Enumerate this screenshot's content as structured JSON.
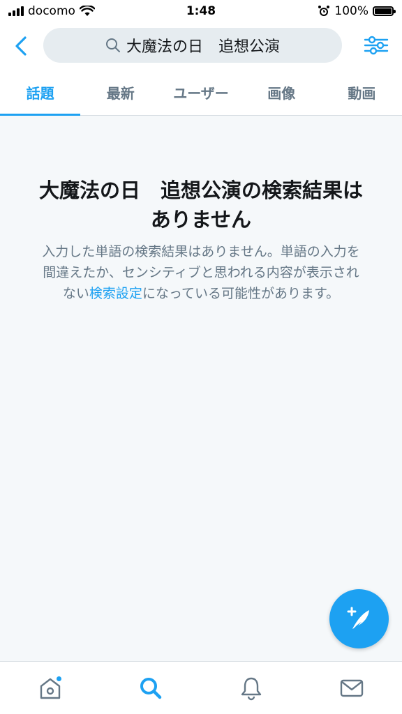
{
  "status_bar": {
    "carrier": "docomo",
    "time": "1:48",
    "battery": "100%",
    "battery_level": 1.0
  },
  "search": {
    "query": "大魔法の日　追想公演"
  },
  "tabs": [
    {
      "label": "話題",
      "active": true
    },
    {
      "label": "最新",
      "active": false
    },
    {
      "label": "ユーザー",
      "active": false
    },
    {
      "label": "画像",
      "active": false
    },
    {
      "label": "動画",
      "active": false
    }
  ],
  "empty_state": {
    "title": "大魔法の日　追想公演の検索結果はありません",
    "desc_before": "入力した単語の検索結果はありません。単語の入力を間違えたか、センシティブと思われる内容が表示されない",
    "link": "検索設定",
    "desc_after": "になっている可能性があります。"
  },
  "colors": {
    "accent": "#1da1f2",
    "secondary_text": "#657786",
    "content_bg": "#f5f8fa"
  },
  "icons": {
    "back": "chevron-left-icon",
    "search": "search-icon",
    "filter": "sliders-icon",
    "compose": "compose-feather-icon",
    "home": "home-icon",
    "explore": "search-icon",
    "notifications": "bell-icon",
    "messages": "mail-icon"
  }
}
